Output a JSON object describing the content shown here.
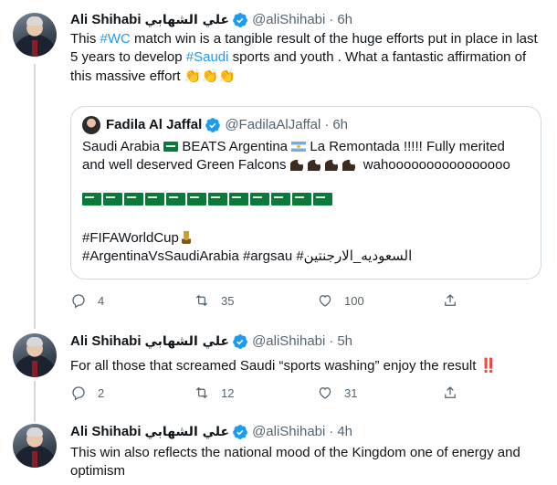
{
  "colors": {
    "link": "#1d9bf0",
    "muted": "#536471",
    "text": "#0f1419",
    "border": "#cfd9de",
    "verified": "#1d9bf0"
  },
  "tweets": [
    {
      "name": "Ali Shihabi",
      "name_ar": "علي الشهابي",
      "handle": "@aliShihabi",
      "separator": "·",
      "time": "6h",
      "text_1": "This ",
      "tag_wc": "#WC",
      "text_2": " match win is a tangible result of the huge efforts put in place in last 5 years to develop ",
      "tag_saudi": "#Saudi",
      "text_3": " sports and youth . What a fantastic affirmation of this massive effort ",
      "emoji_clap": "👏👏👏",
      "quote": {
        "name": "Fadila Al Jaffal",
        "handle": "@FadilaAlJaffal",
        "separator": "·",
        "time": "6h",
        "line_1a": "Saudi Arabia ",
        "line_1b": " BEATS Argentina ",
        "line_1c": " La Remontada !!!!! Fully merited",
        "line_2a": "and well deserved Green Falcons ",
        "line_2b": " wahoooooooooooooooo",
        "saudi_flags_count": 12,
        "hashtag_1": "#FIFAWorldCup",
        "hashtag_2": "#ArgentinaVsSaudiArabia #argsau #السعوديه_الارجنتين"
      },
      "reply_count": "4",
      "retweet_count": "35",
      "like_count": "100"
    },
    {
      "name": "Ali Shihabi",
      "name_ar": "علي الشهابي",
      "handle": "@aliShihabi",
      "separator": "·",
      "time": "5h",
      "text": "For all those that screamed Saudi “sports washing” enjoy the result ",
      "emoji": "‼️",
      "reply_count": "2",
      "retweet_count": "12",
      "like_count": "31"
    },
    {
      "name": "Ali Shihabi",
      "name_ar": "علي الشهابي",
      "handle": "@aliShihabi",
      "separator": "·",
      "time": "4h",
      "text": "This win also reflects the national mood of the Kingdom one of energy and optimism"
    }
  ]
}
